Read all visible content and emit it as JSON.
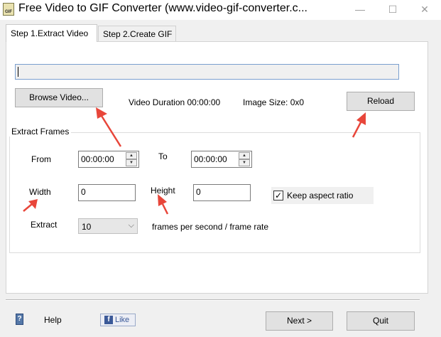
{
  "window": {
    "title": "Free Video to GIF Converter (www.video-gif-converter.c...",
    "icon_text": "GIF",
    "minimize_glyph": "—",
    "maximize_glyph": "☐",
    "close_glyph": "✕"
  },
  "tabs": [
    {
      "label": "Step 1.Extract Video",
      "active": true
    },
    {
      "label": "Step 2.Create GIF",
      "active": false
    }
  ],
  "video": {
    "path_value": "",
    "browse_label": "Browse Video...",
    "duration_text": "Video Duration 00:00:00",
    "image_size_text": "Image Size: 0x0",
    "reload_label": "Reload"
  },
  "extract_frames": {
    "group_title": "Extract Frames",
    "from_label": "From",
    "from_value": "00:00:00",
    "to_label": "To",
    "to_value": "00:00:00",
    "width_label": "Width",
    "width_value": "0",
    "height_label": "Height",
    "height_value": "0",
    "keep_aspect_label": "Keep aspect ratio",
    "keep_aspect_checked": true,
    "extract_label": "Extract",
    "extract_value": "10",
    "fps_label": "frames per second / frame rate"
  },
  "footer": {
    "help_icon_text": "?",
    "help_label": "Help",
    "like_label": "Like",
    "like_icon_text": "f",
    "next_label": "Next >",
    "quit_label": "Quit"
  },
  "colors": {
    "annotation_arrow": "#e8463a",
    "facebook": "#3b5998",
    "input_focus_border": "#7a9fcf"
  },
  "icons": {
    "app": "gif-app-icon",
    "help": "help-book-icon",
    "like": "facebook-like-icon",
    "spin_up": "▲",
    "spin_down": "▼",
    "dropdown": "⌵",
    "check": "✓"
  }
}
